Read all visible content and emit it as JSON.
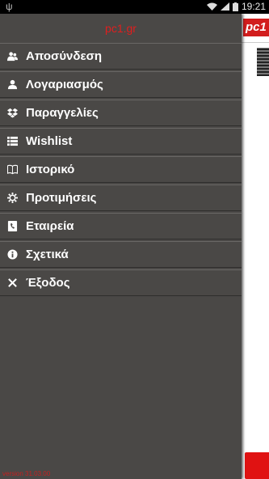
{
  "status_bar": {
    "time": "19:21"
  },
  "drawer": {
    "title": "pc1.gr",
    "items": [
      {
        "label": "Αποσύνδεση",
        "icon": "logout-users-icon"
      },
      {
        "label": "Λογαριασμός",
        "icon": "user-icon"
      },
      {
        "label": "Παραγγελίες",
        "icon": "dropbox-icon"
      },
      {
        "label": "Wishlist",
        "icon": "list-icon"
      },
      {
        "label": "Ιστορικό",
        "icon": "book-icon"
      },
      {
        "label": "Προτιμήσεις",
        "icon": "gear-icon"
      },
      {
        "label": "Εταιρεία",
        "icon": "phone-book-icon"
      },
      {
        "label": "Σχετικά",
        "icon": "info-icon"
      },
      {
        "label": "Έξοδος",
        "icon": "close-icon"
      }
    ],
    "version": "version 31.03.00"
  },
  "content": {
    "logo_text": "pc1"
  },
  "colors": {
    "drawer_bg": "#4a4846",
    "accent_red": "#e01e1e",
    "content_bg": "#ffffff"
  }
}
